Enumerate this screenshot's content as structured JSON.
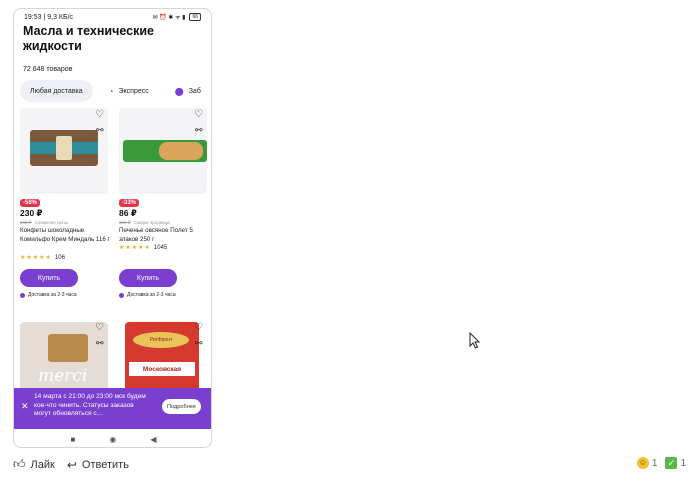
{
  "status": {
    "time_info": "19:53 | 9,3 КБ/с",
    "icons": "✉ ⏰ ✱ ᯤ ▮",
    "battery": "66"
  },
  "page": {
    "title": "Масла и технические жидкости",
    "count": "72 648 товаров"
  },
  "filters": [
    {
      "label": "Любая доставка",
      "icon": ""
    },
    {
      "label": "Экспресс",
      "icon": "express-icon"
    },
    {
      "label": "Заб",
      "icon": "location-icon"
    }
  ],
  "products": [
    {
      "discount": "-58%",
      "price": "230 ₽",
      "old_price": "549 ₽",
      "old_note": "Снижение цены",
      "name": "Конфеты шоколадные Комильфо Крем Миндаль 116 г",
      "stars": "★★★★★",
      "reviews": "106",
      "buy": "Купить",
      "delivery": "Доставка за 2-3 часа"
    },
    {
      "discount": "-33%",
      "price": "86 ₽",
      "old_price": "129 ₽",
      "old_note": "Скидка продавца",
      "name": "Печенье овсяное Полет 5 злаков 250 г",
      "stars": "★★★★★",
      "reviews": "1045",
      "buy": "Купить",
      "delivery": "Доставка за 2-3 часа"
    },
    {
      "brand_text": "merci"
    },
    {
      "brand_text": "РотФронт",
      "label_text": "Московская"
    }
  ],
  "banner": {
    "text": "14 марта с 21:00 до 23:00 мск будем кое-что чинить. Статусы заказов могут обновляться с…",
    "button": "Подробнее",
    "close": "✕"
  },
  "navbar": {
    "square": "■",
    "home": "◉",
    "back": "◀"
  },
  "actions": {
    "like": "Лайк",
    "reply": "Ответить"
  },
  "reactions": [
    {
      "icon": "grin-emoji-icon",
      "count": "1"
    },
    {
      "icon": "check-mark-icon",
      "count": "1"
    }
  ],
  "colors": {
    "accent": "#7b3fd0",
    "discount": "#e8334a",
    "stars": "#f5a623"
  }
}
